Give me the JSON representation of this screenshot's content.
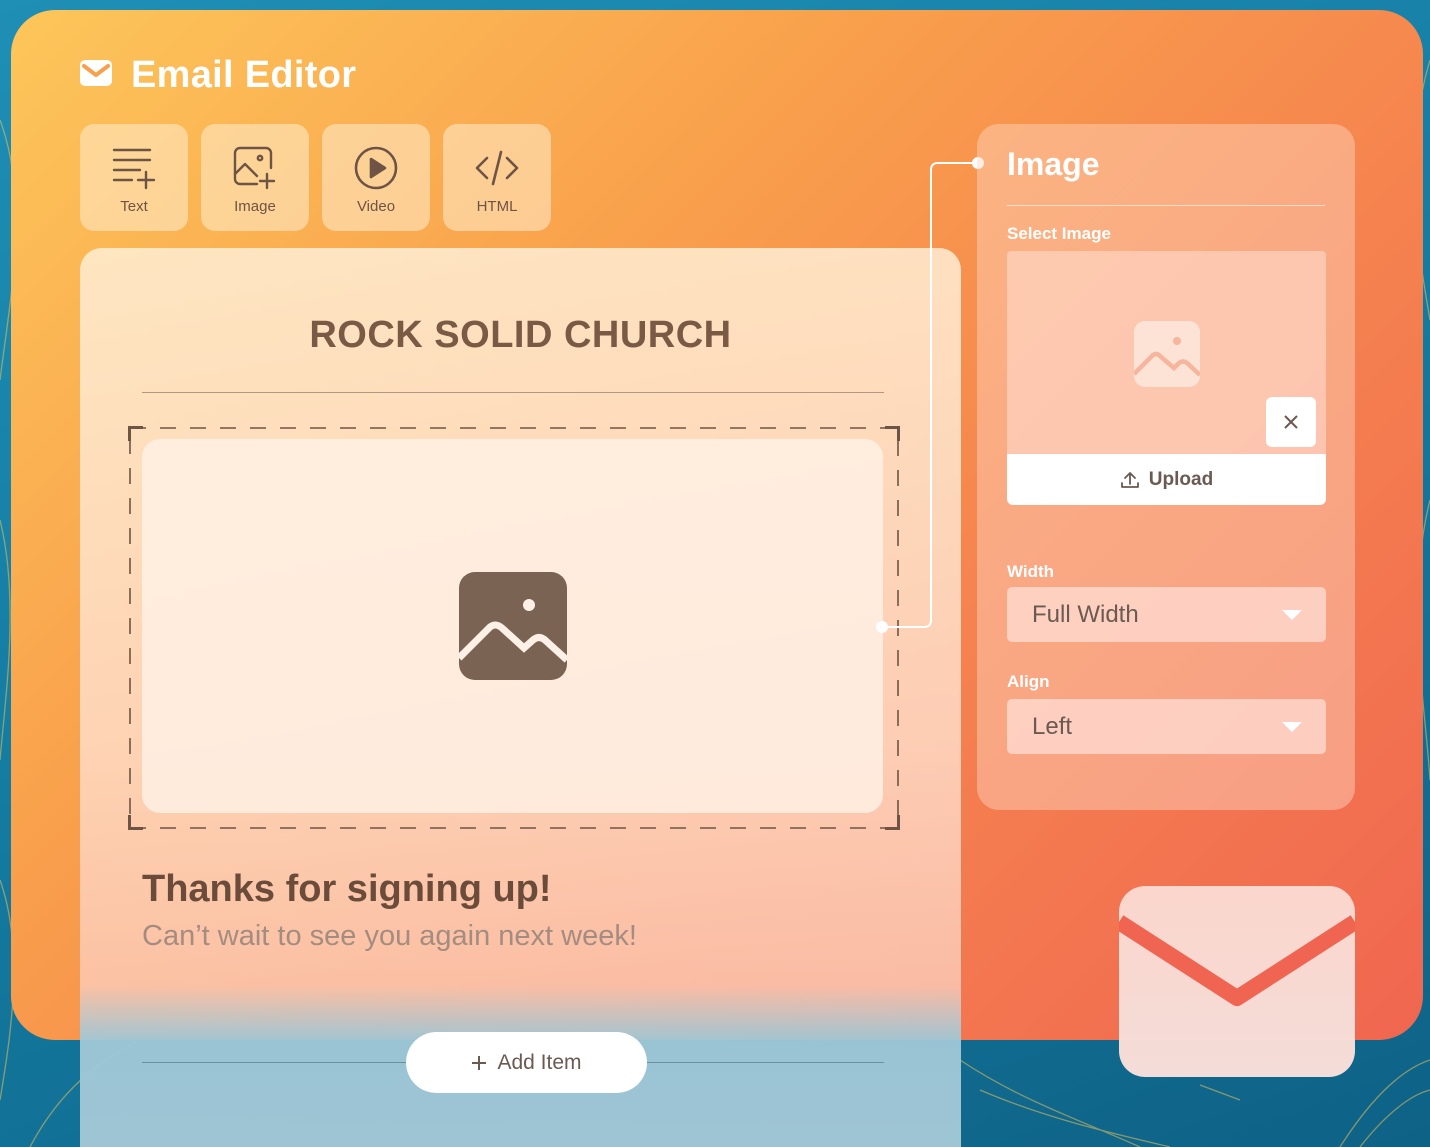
{
  "app": {
    "title": "Email Editor"
  },
  "toolbar": {
    "items": [
      {
        "label": "Text",
        "icon": "text-add-icon"
      },
      {
        "label": "Image",
        "icon": "image-add-icon"
      },
      {
        "label": "Video",
        "icon": "play-icon"
      },
      {
        "label": "HTML",
        "icon": "code-icon"
      }
    ]
  },
  "email": {
    "heading": "ROCK SOLID CHURCH",
    "thanks": "Thanks for signing up!",
    "subtext": "Can’t wait to see you again next week!",
    "add_item_label": "Add Item"
  },
  "panel": {
    "title": "Image",
    "select_image_label": "Select Image",
    "upload_label": "Upload",
    "width_label": "Width",
    "width_value": "Full Width",
    "align_label": "Align",
    "align_value": "Left"
  },
  "colors": {
    "accent_brown": "#7a5a45",
    "card_orange": "#f5824f",
    "background_blue": "#147aa0"
  }
}
